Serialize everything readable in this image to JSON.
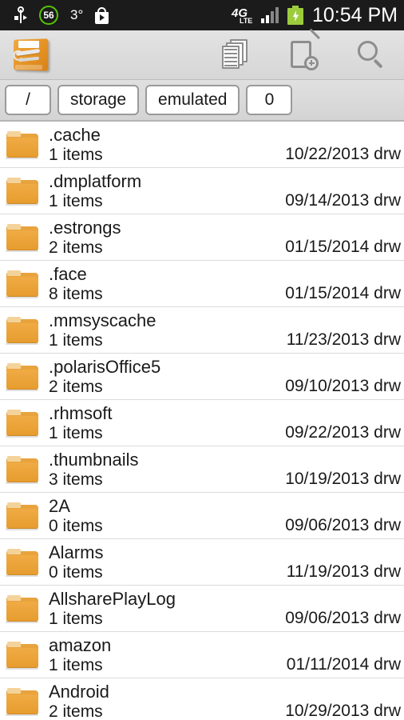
{
  "status_bar": {
    "usb_icon": "usb-icon",
    "battery_percent_badge": "56",
    "temperature": "3°",
    "play_store_icon": "play-store-icon",
    "network_type_main": "4G",
    "network_type_sub": "LTE",
    "signal_icon": "signal-bars-icon",
    "battery_icon": "battery-charging-icon",
    "clock": "10:54 PM",
    "background_color": "#1b1b1b",
    "battery_color": "#9ccc3c",
    "badge_color": "#56c505"
  },
  "app_bar": {
    "app_icon": "file-manager-toolbox-icon",
    "actions": [
      {
        "name": "copy-icon",
        "label": "Copy"
      },
      {
        "name": "new-file-icon",
        "label": "New"
      },
      {
        "name": "search-icon",
        "label": "Search"
      }
    ]
  },
  "breadcrumb": {
    "crumbs": [
      {
        "label": "/",
        "wide": false
      },
      {
        "label": "storage",
        "wide": true
      },
      {
        "label": "emulated",
        "wide": true
      },
      {
        "label": "0",
        "wide": false
      }
    ]
  },
  "file_list": {
    "permission_suffix": "drw",
    "rows": [
      {
        "name": ".cache",
        "items": "1 items",
        "date": "10/22/2013",
        "perm": "drw"
      },
      {
        "name": ".dmplatform",
        "items": "1 items",
        "date": "09/14/2013",
        "perm": "drw"
      },
      {
        "name": ".estrongs",
        "items": "2 items",
        "date": "01/15/2014",
        "perm": "drw"
      },
      {
        "name": ".face",
        "items": "8 items",
        "date": "01/15/2014",
        "perm": "drw"
      },
      {
        "name": ".mmsyscache",
        "items": "1 items",
        "date": "11/23/2013",
        "perm": "drw"
      },
      {
        "name": ".polarisOffice5",
        "items": "2 items",
        "date": "09/10/2013",
        "perm": "drw"
      },
      {
        "name": ".rhmsoft",
        "items": "1 items",
        "date": "09/22/2013",
        "perm": "drw"
      },
      {
        "name": ".thumbnails",
        "items": "3 items",
        "date": "10/19/2013",
        "perm": "drw"
      },
      {
        "name": "2A",
        "items": "0 items",
        "date": "09/06/2013",
        "perm": "drw"
      },
      {
        "name": "Alarms",
        "items": "0 items",
        "date": "11/19/2013",
        "perm": "drw"
      },
      {
        "name": "AllsharePlayLog",
        "items": "1 items",
        "date": "09/06/2013",
        "perm": "drw"
      },
      {
        "name": "amazon",
        "items": "1 items",
        "date": "01/11/2014",
        "perm": "drw"
      },
      {
        "name": "Android",
        "items": "2 items",
        "date": "10/29/2013",
        "perm": "drw"
      }
    ],
    "folder_icon": "folder-icon",
    "folder_color": "#e8a33d"
  }
}
